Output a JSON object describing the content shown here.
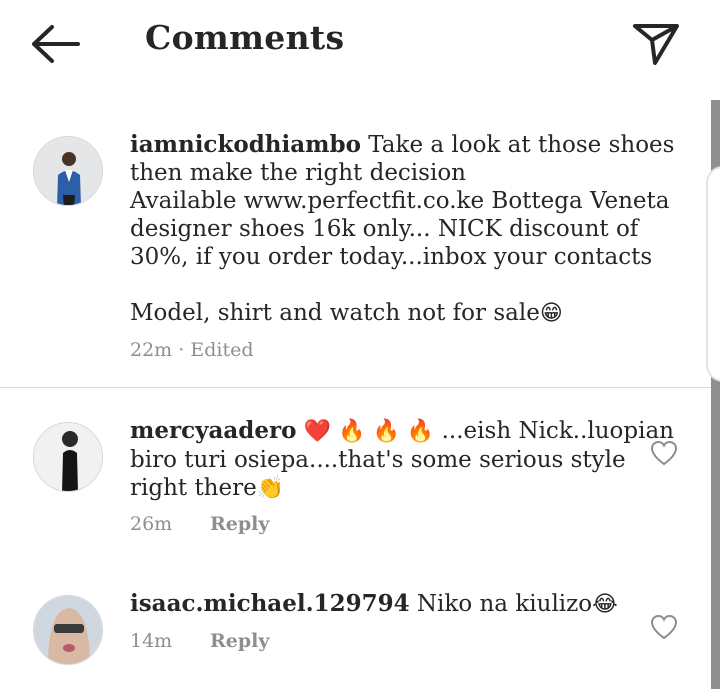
{
  "header": {
    "title": "Comments"
  },
  "caption": {
    "username": "iamnickodhiambo",
    "lines": [
      "Take a look at those shoes",
      "then make the right decision",
      "Available www.perfectfit.co.ke  Bottega Veneta",
      "designer shoes 16k only... NICK discount of",
      "30%, if you order today...inbox your contacts",
      "Model, shirt and watch not for sale"
    ],
    "emoji": "😁",
    "time": "22m",
    "edited": "· Edited"
  },
  "comments": [
    {
      "username": "mercyaadero",
      "emojis": "❤️ 🔥 🔥 🔥",
      "line1": "...eish Nick..luopian",
      "line2": "biro turi osiepa....that's some serious style",
      "line3": "right there",
      "line3_emoji": "👏",
      "time": "26m",
      "reply": "Reply"
    },
    {
      "username": "isaac.michael.129794",
      "text": "Niko na kiulizo",
      "emoji": "😂",
      "time": "14m",
      "reply": "Reply"
    }
  ],
  "colors": {
    "text": "#262626",
    "muted": "#8e8e8e",
    "divider": "#dbdbdb",
    "scrollbar": "#8f8f8f"
  },
  "icons": [
    "back-arrow-icon",
    "send-icon",
    "heart-icon"
  ]
}
